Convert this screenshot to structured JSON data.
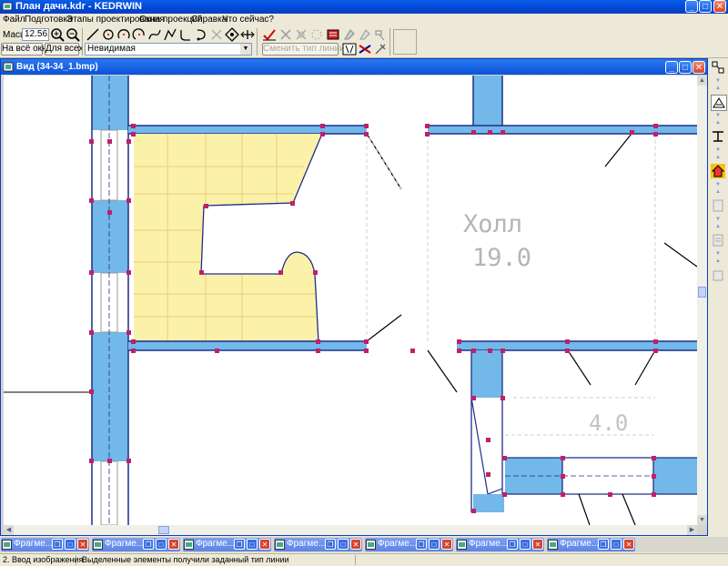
{
  "app": {
    "title": "План дачи.kdr - KEDRWIN",
    "window_buttons": {
      "minimize": "_",
      "maximize": "□",
      "close": "✕"
    }
  },
  "menu": [
    "Файл",
    "Подготовка",
    "Этапы проектирования",
    "Окна проекций",
    "Справка",
    "Что сейчас?"
  ],
  "toolbar": {
    "scale_label": "Масшт",
    "scale_value": "12.5616",
    "fit_all_window": "На всё окно",
    "fit_all": "Для всех",
    "line_type_value": "Невидимая",
    "change_line_type": "Сменить тип линии",
    "tools": [
      "line-icon",
      "circle-icon",
      "arc-icon",
      "arc-cw-icon",
      "spline-icon",
      "polyline-icon",
      "curve-icon",
      "hook-icon",
      "trim-icon",
      "snap-icon",
      "cross-icon"
    ],
    "tools2": [
      "check-line-icon",
      "delete-line-icon",
      "transform-icon",
      "dashed-icon",
      "color-icon"
    ]
  },
  "view_window": {
    "title": "Вид (34-34_1.bmp)"
  },
  "plan": {
    "room_name": "Холл",
    "room_area": "19.0",
    "room2_area": "4.0"
  },
  "fragments": {
    "label": "Фрагме...",
    "count": 7
  },
  "status": {
    "panel1": "2. Ввод изображения",
    "panel2": "Выделенные элементы получили заданный тип линии"
  },
  "colors": {
    "titlebar": "#0046d5",
    "wall_fill": "#72b8e8",
    "stair_fill": "#fbf1a8",
    "node": "#c0206a",
    "line": "#1f2d8a"
  }
}
